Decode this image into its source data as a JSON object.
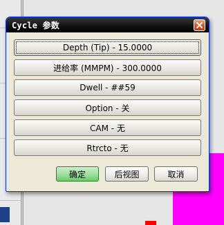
{
  "dialog": {
    "title": "Cycle 参数",
    "params": [
      {
        "label": "Depth (Tip) - 15.0000"
      },
      {
        "label": "进给率 (MMPM) - 300.0000"
      },
      {
        "label": "Dwell - ##59"
      },
      {
        "label": "Option - 关"
      },
      {
        "label": "CAM - 无"
      },
      {
        "label": "Rtrcto - 无"
      }
    ],
    "buttons": {
      "ok": "确定",
      "back_view": "后视图",
      "cancel": "取消"
    }
  },
  "colors": {
    "titlebar": "#000000",
    "dialog_bg": "#ece9d8",
    "close_button": "#e0542a",
    "ok_button": "#9be09b",
    "magenta_area": "#ff00ff"
  },
  "icons": {
    "close": "close-icon"
  }
}
